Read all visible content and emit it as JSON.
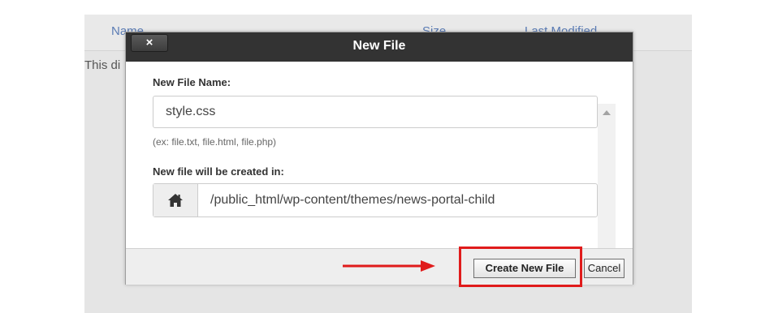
{
  "background": {
    "columns": [
      "Name",
      "Size",
      "Last Modified"
    ],
    "message": "This di"
  },
  "dialog": {
    "title": "New File",
    "close_label": "×",
    "file_name_label": "New File Name:",
    "file_name_value": "style.css",
    "file_name_hint": "(ex: file.txt, file.html, file.php)",
    "location_label": "New file will be created in:",
    "location_icon": "home-icon",
    "location_value": "/public_html/wp-content/themes/news-portal-child",
    "create_button_label": "Create New File",
    "cancel_button_label": "Cancel"
  },
  "annotation": {
    "color": "#e01b1b"
  }
}
